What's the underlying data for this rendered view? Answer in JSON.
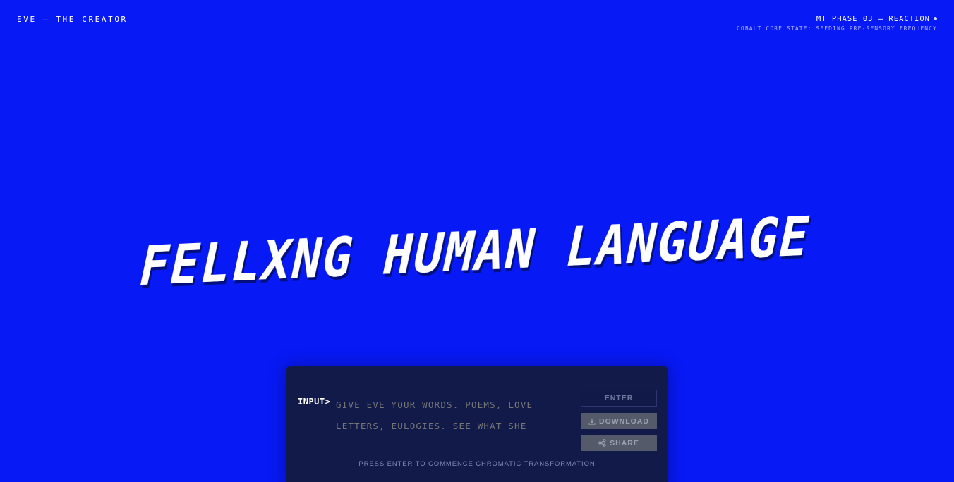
{
  "header": {
    "brand": "EVE — THE CREATOR",
    "phase_title": "MT_PHASE_03 — REACTION",
    "phase_subtitle": "COBALT CORE STATE: SEEDING PRE-SENSORY FREQUENCY",
    "status_dot_color": "#cfd5ff"
  },
  "hero": {
    "headline": "FELLXNG HUMAN LANGUAGE"
  },
  "panel": {
    "prompt_label": "INPUT>",
    "input_placeholder": "GIVE EVE YOUR WORDS. POEMS, LOVE LETTERS, EULOGIES. SEE WHAT SHE GIVES",
    "input_value": "",
    "enter_label": "ENTER",
    "download_label": "DOWNLOAD",
    "share_label": "SHARE",
    "download_icon": "download-icon",
    "share_icon": "share-icon",
    "hint": "PRESS ENTER TO COMMENCE CHROMATIC TRANSFORMATION"
  },
  "colors": {
    "background": "#0719f5",
    "panel": "#121a4a",
    "text": "#ffffff",
    "muted": "#7b82a8",
    "button_disabled": "#545a69"
  }
}
